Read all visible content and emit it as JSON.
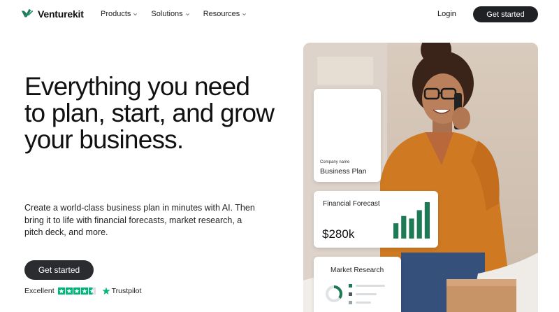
{
  "brand": {
    "name": "Venturekit",
    "accent": "#1f7a5a"
  },
  "nav": {
    "menu": [
      {
        "label": "Products"
      },
      {
        "label": "Solutions"
      },
      {
        "label": "Resources"
      }
    ],
    "login": "Login",
    "cta": "Get started"
  },
  "hero": {
    "headline": "Everything you need to plan, start, and grow your business.",
    "subtext": "Create a world-class business plan in minutes with AI. Then bring it to life with financial forecasts, market research, a pitch deck, and more.",
    "cta": "Get started",
    "rating": {
      "label": "Excellent",
      "stars": 4.5,
      "provider": "Trustpilot",
      "color": "#00b67a"
    }
  },
  "cards": {
    "plan": {
      "small_label": "Company name",
      "title": "Business Plan"
    },
    "forecast": {
      "title": "Financial Forecast",
      "value": "$280k",
      "bars": [
        0.42,
        0.62,
        0.55,
        0.78,
        1.0
      ],
      "bar_color": "#1d7a55"
    },
    "research": {
      "title": "Market Research",
      "donut_fraction": 0.35
    }
  }
}
